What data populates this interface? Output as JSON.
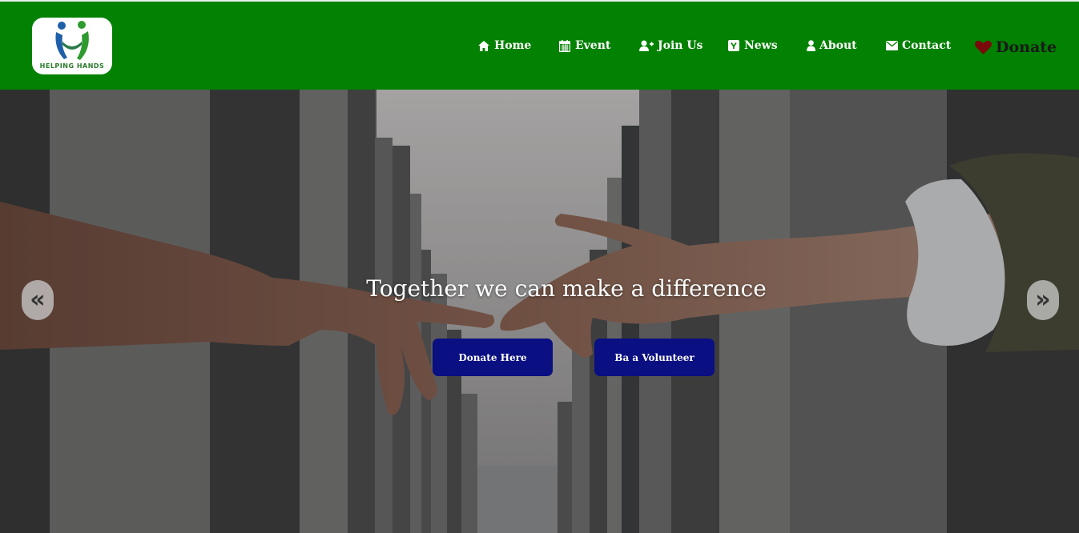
{
  "brand": {
    "logo_text": "HELPING HANDS"
  },
  "nav": {
    "items": [
      {
        "label": "Home",
        "icon": "home-icon"
      },
      {
        "label": "Event",
        "icon": "calendar-icon"
      },
      {
        "label": "Join Us",
        "icon": "user-plus-icon"
      },
      {
        "label": "News",
        "icon": "news-icon"
      },
      {
        "label": "About",
        "icon": "user-icon"
      },
      {
        "label": "Contact",
        "icon": "envelope-icon"
      }
    ],
    "donate_label": "Donate",
    "donate_icon": "heart-icon"
  },
  "hero": {
    "title": "Together we can make a difference",
    "donate_button": "Donate Here",
    "volunteer_button": "Ba a Volunteer",
    "prev_glyph": "«",
    "next_glyph": "»"
  },
  "colors": {
    "navbar": "#028102",
    "button": "#0a0f82",
    "heart": "#7a0a0a"
  }
}
